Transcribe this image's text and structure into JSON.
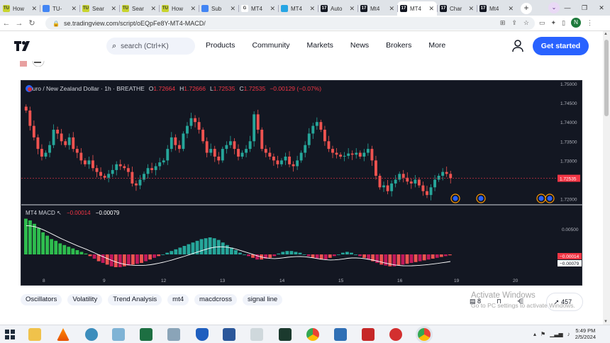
{
  "browser": {
    "tabs": [
      {
        "label": "How",
        "favicon": "TU",
        "color": "#c8d42e",
        "active": false
      },
      {
        "label": "TU-",
        "favicon": "doc",
        "color": "#4285f4",
        "active": false
      },
      {
        "label": "Sear",
        "favicon": "TU",
        "color": "#c8d42e",
        "active": false
      },
      {
        "label": "Sear",
        "favicon": "TU",
        "color": "#c8d42e",
        "active": false
      },
      {
        "label": "How",
        "favicon": "TU",
        "color": "#c8d42e",
        "active": false
      },
      {
        "label": "Sub",
        "favicon": "doc",
        "color": "#4285f4",
        "active": false
      },
      {
        "label": "MT4",
        "favicon": "G",
        "color": "#ffffff",
        "active": false
      },
      {
        "label": "MT4",
        "favicon": "bars",
        "color": "#26a5e4",
        "active": false
      },
      {
        "label": "Auto",
        "favicon": "TV",
        "color": "#131722",
        "active": false
      },
      {
        "label": "Mt4",
        "favicon": "TV",
        "color": "#131722",
        "active": false
      },
      {
        "label": "MT4",
        "favicon": "TV",
        "color": "#131722",
        "active": true
      },
      {
        "label": "Char",
        "favicon": "TV",
        "color": "#131722",
        "active": false
      },
      {
        "label": "Mt4",
        "favicon": "TV",
        "color": "#131722",
        "active": false
      }
    ],
    "url": "se.tradingview.com/script/oEQpFe8Y-MT4-MACD/",
    "profile_initial": "N"
  },
  "header": {
    "search_placeholder": "search (Ctrl+K)",
    "nav": [
      "Products",
      "Community",
      "Markets",
      "News",
      "Brokers",
      "More"
    ],
    "cta": "Get started"
  },
  "chart_data": {
    "type": "candlestick",
    "title": "Euro / New Zealand Dollar · 1h · BREATHE",
    "ohlc": {
      "O": "1.72664",
      "H": "1.72666",
      "L": "1.72535",
      "C": "1.72535",
      "change": "−0.00129 (−0.07%)"
    },
    "ohlc_labels": {
      "O": "O",
      "H": "H",
      "L": "L",
      "C": "C"
    },
    "price_axis": [
      "1.75000",
      "1.74500",
      "1.74000",
      "1.73500",
      "1.73000",
      "1.72500",
      "1.72000"
    ],
    "current_price": "1.72535",
    "time_axis": [
      "8",
      "9",
      "12",
      "13",
      "14",
      "15",
      "16",
      "19",
      "20"
    ],
    "close_series": [
      1.743,
      1.739,
      1.736,
      1.733,
      1.731,
      1.732,
      1.734,
      1.738,
      1.737,
      1.735,
      1.734,
      1.736,
      1.733,
      1.732,
      1.73,
      1.729,
      1.73,
      1.728,
      1.727,
      1.726,
      1.7255,
      1.7265,
      1.7275,
      1.729,
      1.7285,
      1.728,
      1.727,
      1.724,
      1.7235,
      1.725,
      1.7265,
      1.728,
      1.7275,
      1.7285,
      1.7295,
      1.73,
      1.733,
      1.736,
      1.734,
      1.733,
      1.737,
      1.739,
      1.741,
      1.74,
      1.738,
      1.735,
      1.732,
      1.733,
      1.731,
      1.73,
      1.733,
      1.734,
      1.735,
      1.733,
      1.731,
      1.732,
      1.733,
      1.735,
      1.742,
      1.738,
      1.733,
      1.732,
      1.731,
      1.73,
      1.729,
      1.73,
      1.731,
      1.729,
      1.7285,
      1.73,
      1.732,
      1.734,
      1.737,
      1.739,
      1.74,
      1.738,
      1.735,
      1.733,
      1.732,
      1.7315,
      1.731,
      1.7312,
      1.7318,
      1.7315,
      1.732,
      1.731,
      1.732,
      1.733,
      1.73,
      1.726,
      1.723,
      1.7235,
      1.722,
      1.724,
      1.725,
      1.7265,
      1.7255,
      1.7245,
      1.724,
      1.725,
      1.7235,
      1.722,
      1.721,
      1.723,
      1.725,
      1.726,
      1.727,
      1.7265,
      1.7254
    ],
    "macd": {
      "title": "MT4 MACD",
      "macd_value": "−0.00014",
      "signal_value": "−0.00079",
      "axis": [
        "0.00500"
      ],
      "histogram": [
        0.0042,
        0.004,
        0.0036,
        0.0031,
        0.0026,
        0.0022,
        0.0018,
        0.0016,
        0.0013,
        0.0011,
        0.0009,
        0.0007,
        0.0005,
        0.0003,
        0.0001,
        -0.0002,
        -0.0005,
        -0.0008,
        -0.001,
        -0.0012,
        -0.0014,
        -0.0015,
        -0.0015,
        -0.0014,
        -0.0013,
        -0.0012,
        -0.0011,
        -0.001,
        -0.0008,
        -0.0006,
        -0.0004,
        -0.0002,
        0.0,
        0.0002,
        0.0004,
        0.0006,
        0.0008,
        0.001,
        0.0012,
        0.0014,
        0.0016,
        0.0018,
        0.0019,
        0.002,
        0.0019,
        0.0017,
        0.0014,
        0.0011,
        0.0008,
        0.0005,
        0.0002,
        0.0,
        -0.0002,
        -0.0004,
        -0.0006,
        -0.0006,
        -0.0005,
        -0.0004,
        -0.0002,
        0.0001,
        0.0003,
        0.0004,
        0.0004,
        0.0003,
        0.0002,
        0.0,
        -0.0002,
        -0.0004,
        -0.0005,
        -0.0006,
        -0.0006,
        -0.0004,
        -0.0002,
        0.0,
        0.0002,
        0.0003,
        0.0002,
        0.0,
        -0.0002,
        -0.0004,
        -0.0006,
        -0.0008,
        -0.001,
        -0.0012,
        -0.0013,
        -0.0014,
        -0.0014,
        -0.0013,
        -0.0012,
        -0.0011,
        -0.001,
        -0.0009,
        -0.0008,
        -0.0007,
        -0.0006,
        -0.0005,
        -0.0004,
        -0.0003,
        -0.0002,
        -0.0001
      ],
      "colors": {
        "pos": "#26a69a",
        "pos_strong": "#2ebd4e",
        "neg": "#ef5350",
        "neg_dark": "#c2185b"
      }
    }
  },
  "tags": [
    "Oscillators",
    "Volatility",
    "Trend Analysis",
    "mt4",
    "macdcross",
    "signal line"
  ],
  "stats": {
    "comments": "8",
    "boosts": "457"
  },
  "watermark": {
    "line1": "Activate Windows",
    "line2": "Go to PC settings to activate Windows."
  },
  "taskbar": {
    "time": "5:49 PM",
    "date": "2/5/2024"
  },
  "colors": {
    "accent": "#2962ff",
    "up": "#26a69a",
    "down": "#ef5350"
  }
}
